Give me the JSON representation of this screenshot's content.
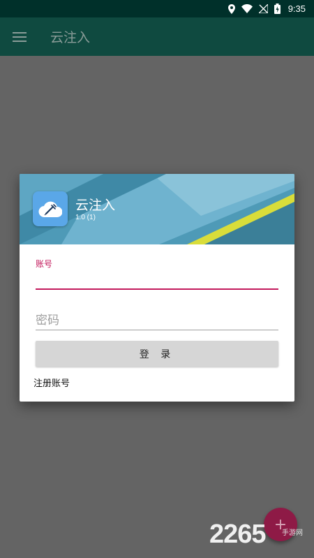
{
  "status_bar": {
    "time": "9:35"
  },
  "toolbar": {
    "title": "云注入"
  },
  "dialog": {
    "app_name": "云注入",
    "app_version": "1.0 (1)",
    "account_label": "账号",
    "account_value": "",
    "password_placeholder": "密码",
    "login_label": "登 录",
    "register_label": "注册账号"
  },
  "fab": {
    "label": "+"
  },
  "watermark": {
    "text": "2265",
    "sub": "手游网"
  },
  "colors": {
    "status_bar": "#00302a",
    "toolbar": "#0f4a40",
    "accent": "#c2185b",
    "scrim": "#646464",
    "fab": "#8e1a46"
  }
}
